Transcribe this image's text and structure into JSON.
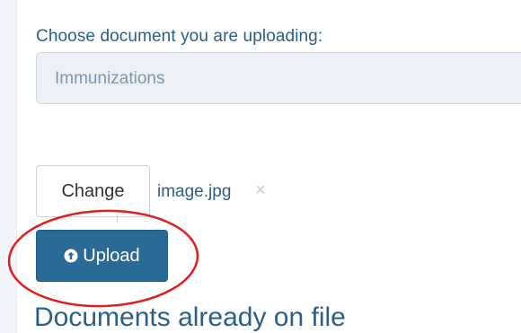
{
  "upload_form": {
    "choose_label": "Choose document you are uploading:",
    "selected_document_type": "Immunizations",
    "change_label": "Change",
    "file_name": "image.jpg",
    "remove_glyph": "×",
    "upload_label": "Upload",
    "upload_icon": "arrow-up-circle-icon"
  },
  "section": {
    "title": "Documents already on file"
  },
  "colors": {
    "label_blue": "#2b5f8a",
    "button_blue": "#2a6a96",
    "annotation_red": "#e02020"
  }
}
